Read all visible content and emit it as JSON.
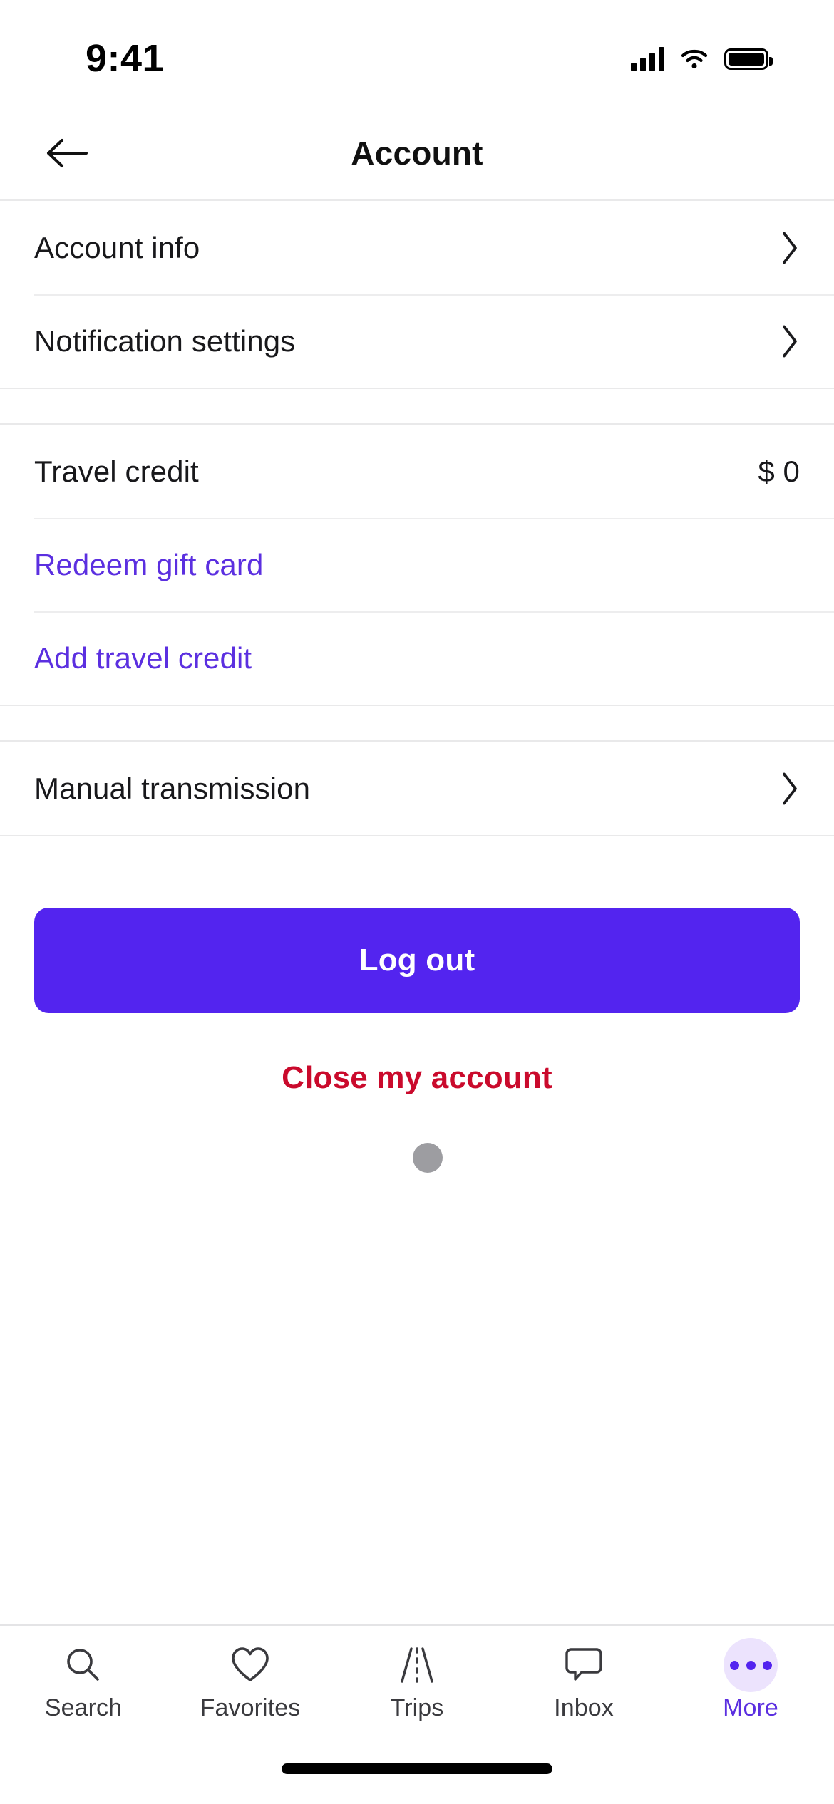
{
  "status_bar": {
    "time": "9:41",
    "signal_icon": "signal-bars-icon",
    "wifi_icon": "wifi-icon",
    "battery_icon": "battery-full-icon"
  },
  "header": {
    "back_icon": "back-arrow-icon",
    "title": "Account"
  },
  "sections": [
    {
      "rows": [
        {
          "label": "Account info",
          "accessory": "chevron-right-icon",
          "type": "nav"
        },
        {
          "label": "Notification settings",
          "accessory": "chevron-right-icon",
          "type": "nav"
        }
      ]
    },
    {
      "rows": [
        {
          "label": "Travel credit",
          "value": "$ 0",
          "type": "value"
        },
        {
          "label": "Redeem gift card",
          "type": "link"
        },
        {
          "label": "Add travel credit",
          "type": "link"
        }
      ]
    },
    {
      "rows": [
        {
          "label": "Manual transmission",
          "accessory": "chevron-right-icon",
          "type": "nav"
        }
      ]
    }
  ],
  "actions": {
    "logout_label": "Log out",
    "close_account_label": "Close my account",
    "loading_dot": "grey-dot-indicator"
  },
  "tabbar": {
    "items": [
      {
        "label": "Search",
        "icon": "search-icon",
        "active": false
      },
      {
        "label": "Favorites",
        "icon": "heart-icon",
        "active": false
      },
      {
        "label": "Trips",
        "icon": "road-icon",
        "active": false
      },
      {
        "label": "Inbox",
        "icon": "chat-bubble-icon",
        "active": false
      },
      {
        "label": "More",
        "icon": "ellipsis-icon",
        "active": true
      }
    ]
  },
  "colors": {
    "brand_purple": "#5324ef",
    "link_purple": "#5b2fe0",
    "danger_red": "#ca0a2c",
    "tab_active": "#5b2fe0",
    "tab_active_bg": "#ece3fd",
    "grey_dot": "#9d9da1",
    "text_primary": "#18181b",
    "divider": "#e9e9ea",
    "background": "#ffffff"
  },
  "home_indicator": "home-indicator-bar"
}
